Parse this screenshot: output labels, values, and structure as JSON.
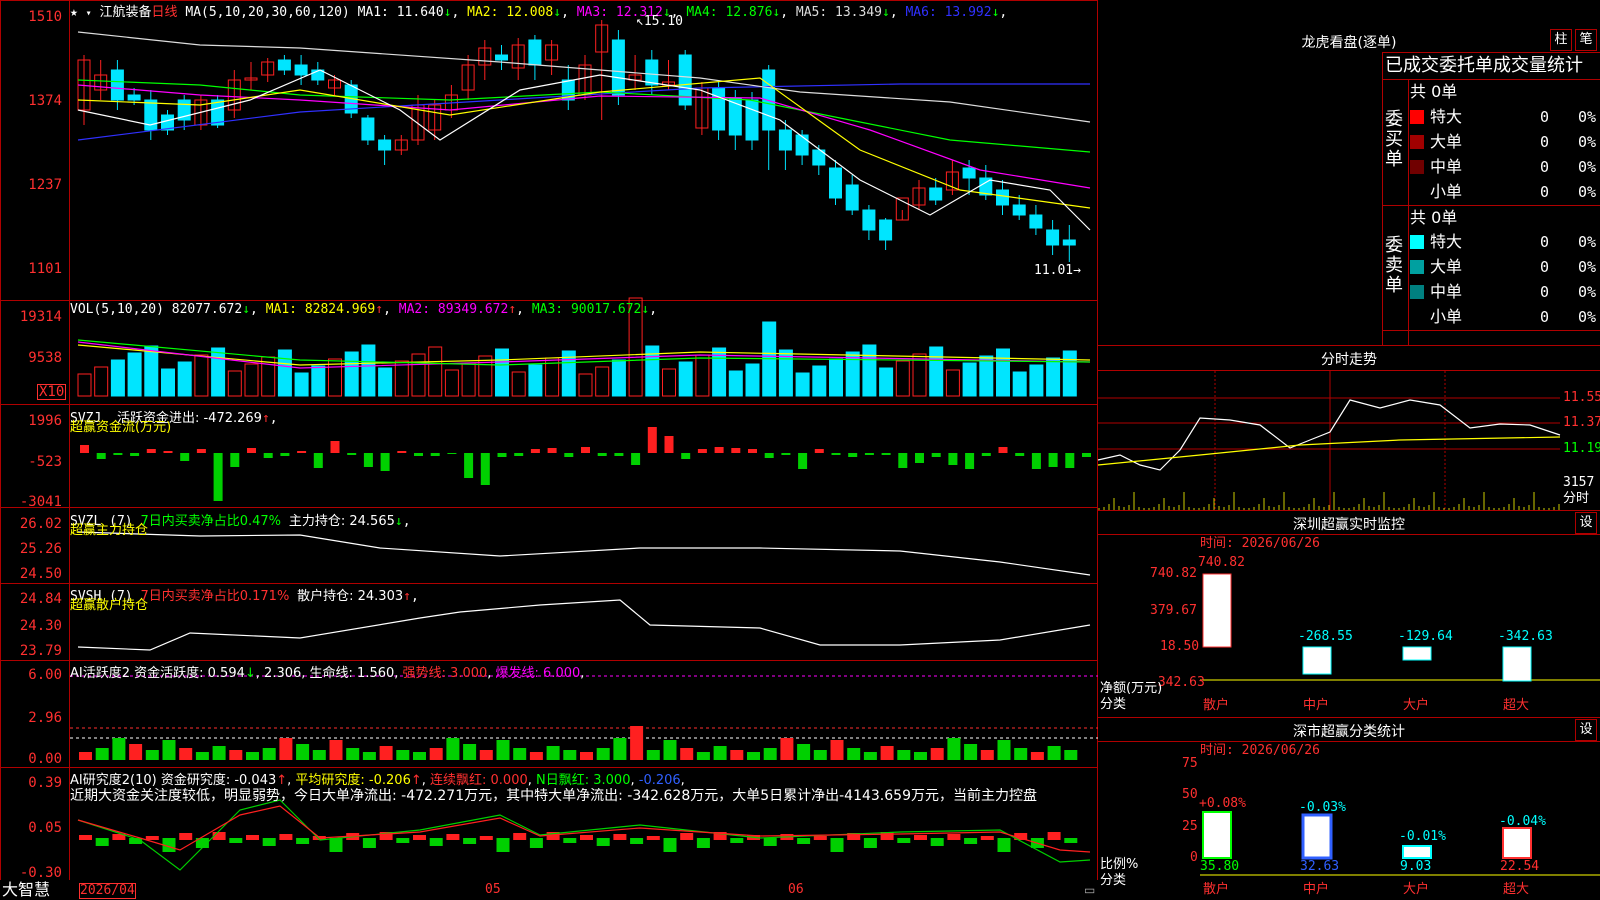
{
  "colors": {
    "up": "#ff2020",
    "down": "#00e5ff",
    "grid": "#b00000",
    "volgreen": "#00d000"
  },
  "kline": {
    "stock_name": "江航装备",
    "period": "日线",
    "ma_params": "MA(5,10,20,30,60,120)",
    "ma_items": [
      {
        "label": "MA1: 11.640",
        "arrow": "↓",
        "color": "#ffffff"
      },
      {
        "label": "MA2: 12.008",
        "arrow": "↓",
        "color": "#ffff00"
      },
      {
        "label": "MA3: 12.312",
        "arrow": "↓",
        "color": "#ff00ff"
      },
      {
        "label": "MA4: 12.876",
        "arrow": "↓",
        "color": "#00ff00"
      },
      {
        "label": "MA5: 13.349",
        "arrow": "↓",
        "color": "#dddddd"
      },
      {
        "label": "MA6: 13.992",
        "arrow": "↓",
        "color": "#3030ff"
      }
    ],
    "y_ticks": [
      "1510",
      "1374",
      "1237",
      "1101"
    ],
    "high_label": "15.10",
    "low_label": "11.01"
  },
  "vol": {
    "title": "VOL(5,10,20)",
    "value": "82077.672",
    "value_arrow": "↓",
    "items": [
      {
        "label": "MA1: 82824.969",
        "arrow": "↑",
        "color": "#ffff00"
      },
      {
        "label": "MA2: 89349.672",
        "arrow": "↑",
        "color": "#ff00ff"
      },
      {
        "label": "MA3: 90017.672",
        "arrow": "↓",
        "color": "#00ff00"
      }
    ],
    "y_ticks": [
      "19314",
      "9538"
    ],
    "unit": "X10"
  },
  "svzj": {
    "title": "SVZJ",
    "text": "活跃资金进出: -472.269",
    "arrow": "↑",
    "sub": "超赢资金流(万元)",
    "y_ticks": [
      "1996",
      "-523",
      "-3041"
    ]
  },
  "svzl": {
    "title": "SVZL (7)",
    "text1": "7日内买卖净占比0.47%",
    "text2": "主力持仓: 24.565",
    "arrow": "↓",
    "sub": "超赢主力持仓",
    "y_ticks": [
      "26.02",
      "25.26",
      "24.50"
    ]
  },
  "svsh": {
    "title": "SVSH (7)",
    "text1": "7日内买卖净占比0.171%",
    "text2": "散户持仓: 24.303",
    "arrow": "↑",
    "sub": "超赢散户持仓",
    "y_ticks": [
      "24.84",
      "24.30",
      "23.79"
    ]
  },
  "ai1": {
    "title": "AI活跃度2",
    "t1": "资金活跃度: 0.594",
    "a1": "↓",
    "t2": "2.306",
    "t3": "生命线: 1.560",
    "t4": "强势线: 3.000",
    "t5": "爆发线: 6.000",
    "y_ticks": [
      "6.00",
      "2.96",
      "0.00"
    ]
  },
  "ai2": {
    "title": "AI研究度2(10)",
    "t1": "资金研究度: -0.043",
    "a1": "↑",
    "t2": "平均研究度: -0.206",
    "a2": "↑",
    "t3": "连续飘红: 0.000",
    "t4": "N日飘红: 3.000",
    "t5": "-0.206",
    "comment": "近期大资金关注度较低，明显弱势，今日大单净流出: -472.271万元，其中特大单净流出: -342.628万元，大单5日累计净出-4143.659万元，当前主力控盘",
    "y_ticks": [
      "0.39",
      "0.05",
      "-0.30"
    ]
  },
  "bottom": {
    "logo": "大智慧",
    "date": "2026/04",
    "m1": "05",
    "m2": "06"
  },
  "lhb": {
    "title": "龙虎看盘(逐单)",
    "btn1": "柱",
    "btn2": "笔",
    "subtitle": "已成交委托单成交量统计",
    "buy_label": "委买单",
    "sell_label": "委卖单",
    "buy_total": "共 0单",
    "sell_total": "共 0单",
    "buy_rows": [
      {
        "name": "特大",
        "v": "0",
        "p": "0%",
        "color": "#ff0000"
      },
      {
        "name": "大单",
        "v": "0",
        "p": "0%",
        "color": "#a00000"
      },
      {
        "name": "中单",
        "v": "0",
        "p": "0%",
        "color": "#700000"
      },
      {
        "name": "小单",
        "v": "0",
        "p": "0%",
        "color": "#000000"
      }
    ],
    "sell_rows": [
      {
        "name": "特大",
        "v": "0",
        "p": "0%",
        "color": "#00ffff"
      },
      {
        "name": "大单",
        "v": "0",
        "p": "0%",
        "color": "#00a0a0"
      },
      {
        "name": "中单",
        "v": "0",
        "p": "0%",
        "color": "#008080"
      },
      {
        "name": "小单",
        "v": "0",
        "p": "0%",
        "color": "#000000"
      }
    ]
  },
  "fenshi": {
    "title": "分时走势",
    "y_ticks": [
      "11.55",
      "11.37",
      "11.19"
    ],
    "vol_top": "3157",
    "vol_unit": "分时"
  },
  "monitor": {
    "title": "深圳超赢实时监控",
    "btn": "设",
    "date": "时间: 2026/06/26",
    "y_ticks": [
      "740.82",
      "379.67",
      "18.50",
      "-342.63"
    ],
    "ylabel1": "净额(万元)",
    "ylabel2": "分类",
    "bars": [
      {
        "cat": "散户",
        "value": "740.82"
      },
      {
        "cat": "中户",
        "value": "-268.55"
      },
      {
        "cat": "大户",
        "value": "-129.64"
      },
      {
        "cat": "超大",
        "value": "-342.63"
      }
    ]
  },
  "classify": {
    "title": "深市超赢分类统计",
    "btn": "设",
    "date": "时间: 2026/06/26",
    "y_ticks": [
      "75",
      "50",
      "25",
      "0"
    ],
    "ylabel1": "比例%",
    "ylabel2": "分类",
    "bars": [
      {
        "cat": "散户",
        "top": "+0.08%",
        "bottom": "35.80"
      },
      {
        "cat": "中户",
        "top": "-0.03%",
        "bottom": "32.63"
      },
      {
        "cat": "大户",
        "top": "-0.01%",
        "bottom": "9.03"
      },
      {
        "cat": "超大",
        "top": "-0.04%",
        "bottom": "22.54"
      }
    ]
  }
}
